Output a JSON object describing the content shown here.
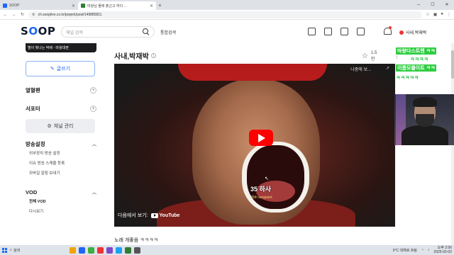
{
  "browser": {
    "tabs": [
      {
        "title": "SOOP",
        "active": false
      },
      {
        "title": "마왕님 몰래 출근고 하다 ...",
        "active": true
      }
    ],
    "new_tab": "+",
    "url": "ch.sooplive.co.kr/jwqnrk/post/149885811"
  },
  "header": {
    "logo_prefix": "S",
    "logo_o": "O",
    "logo_suffix": "OP",
    "search_placeholder": "채널 검색",
    "unified_search": "통합검색",
    "user_name": "사내,박재박"
  },
  "sidebar": {
    "banner_text": "별이 빛나는 박배 - 마왕대편",
    "write_button": "글쓰기",
    "sections": [
      {
        "label": "열혈팬"
      },
      {
        "label": "서포터"
      }
    ],
    "channel_manage": "채널 관리",
    "broadcast_settings": {
      "label": "방송설정",
      "items": [
        "외부장치 방송 설정",
        "이슈 방송 스케줄 등록",
        "모바일 알림 보내기"
      ]
    },
    "vod": {
      "label": "VOD",
      "items": [
        "전체 VOD",
        "다시보기"
      ]
    }
  },
  "post": {
    "title": "사내,박재박",
    "likes": "1.5만",
    "description": "노래 개좋음 ㅋㅋㅋㅋ"
  },
  "video": {
    "top_overlay": "나중에 보...",
    "caption_main": "35 하사",
    "caption_sub": "35th sergeant",
    "watch_on": "다음에서 보기:",
    "youtube": "YouTube"
  },
  "overlay": {
    "chat": [
      {
        "text": "마왕다스트렌 ㅋㅋ",
        "color": "#1fbf3a"
      },
      {
        "text": "ㅋㅋㅋㅋ",
        "color": "#1fbf3a"
      },
      {
        "text": "이름모를이트 ㅋㅋ",
        "color": "#1fbf3a"
      },
      {
        "text": "ㅋㅋㅋㅋㅋ",
        "color": "#1fbf3a"
      }
    ]
  },
  "taskbar": {
    "search": "검색",
    "weather": "0°C 대체로 흐림",
    "time": "오후 2:56",
    "date": "2025-02-02"
  },
  "colors": {
    "accent": "#1e66f5",
    "live": "#ff0000"
  }
}
